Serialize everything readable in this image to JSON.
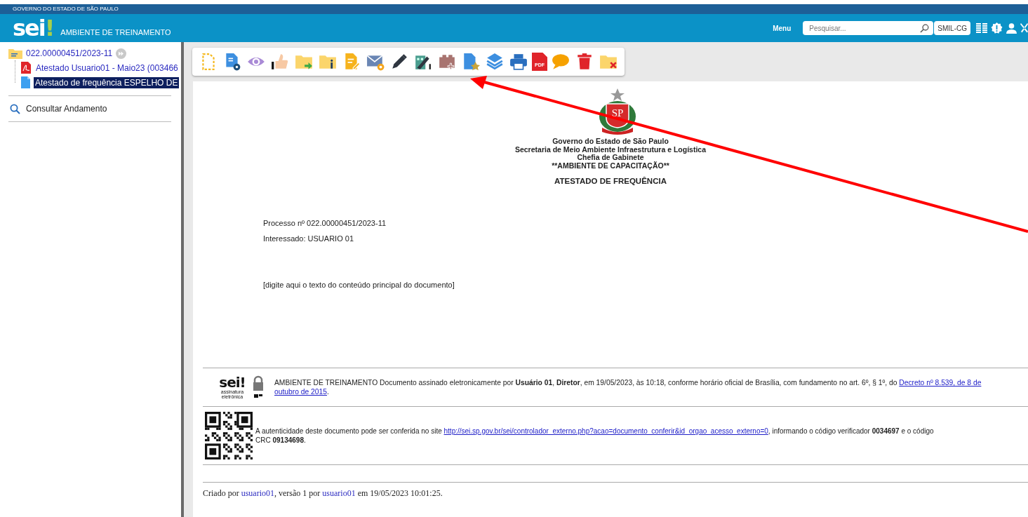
{
  "gov_bar": {
    "title": "GOVERNO DO ESTADO DE SÃO PAULO"
  },
  "header": {
    "logo": "sei",
    "logo_mark": "!",
    "environment": "AMBIENTE DE TREINAMENTO",
    "menu": "Menu",
    "search": {
      "placeholder": "Pesquisar..."
    },
    "unit": "SMIL-CG"
  },
  "tree": {
    "label": "022.00000451/2023-11",
    "children": [
      {
        "label": "Atestado Usuario01 - Maio23 (003466",
        "kind": "pdf",
        "selected": false
      },
      {
        "label": "Atestado de frequência ESPELHO DE",
        "kind": "document",
        "selected": true
      }
    ]
  },
  "sidebar_links": [
    {
      "label": "Consultar Andamento"
    }
  ],
  "toolbar": {
    "pdf_label": "PDF"
  },
  "document": {
    "emblem_text": "SP",
    "heading_lines": [
      "Governo do Estado de São Paulo",
      "Secretaria de Meio Ambiente Infraestrutura e Logística",
      "Chefia de Gabinete",
      "**AMBIENTE DE CAPACITAÇÃO**"
    ],
    "title": "ATESTADO DE FREQUÊNCIA",
    "fields": [
      "Processo nº 022.00000451/2023-11",
      "Interessado: USUARIO 01"
    ],
    "body": "[digite aqui o texto do conteúdo principal do documento]",
    "signature": {
      "logo": "sei!",
      "logo_caption": "assinatura eletrônica",
      "parts": [
        {
          "kind": "text",
          "text": "AMBIENTE DE TREINAMENTO Documento assinado eletronicamente por **Usuário 01**, **Diretor**, em 19/05/2023, às 10:18, conforme horário oficial de Brasília, com fundamento no art. 6º, § 1º, do "
        },
        {
          "kind": "link",
          "text": "Decreto nº 8.539, de 8 de"
        },
        {
          "kind": "break"
        },
        {
          "kind": "link",
          "text": "outubro de 2015"
        },
        {
          "kind": "text",
          "text": "."
        }
      ]
    },
    "verification": {
      "parts": [
        {
          "kind": "text",
          "text": "A autenticidade deste documento pode ser conferida no site "
        },
        {
          "kind": "link",
          "text": "http://sei.sp.gov.br/sei/controlador_externo.php?acao=documento_conferir&id_orgao_acesso_externo=0"
        },
        {
          "kind": "text",
          "text": ", informando o código verificador **0034697** e o código"
        },
        {
          "kind": "break"
        },
        {
          "kind": "text",
          "text": "CRC **09134698**."
        }
      ]
    },
    "footer": {
      "parts": [
        {
          "kind": "text",
          "text": "Criado por "
        },
        {
          "kind": "link",
          "text": "usuario01"
        },
        {
          "kind": "text",
          "text": ", versão 1 por "
        },
        {
          "kind": "link",
          "text": "usuario01"
        },
        {
          "kind": "text",
          "text": " em 19/05/2023 10:01:25."
        }
      ]
    }
  }
}
